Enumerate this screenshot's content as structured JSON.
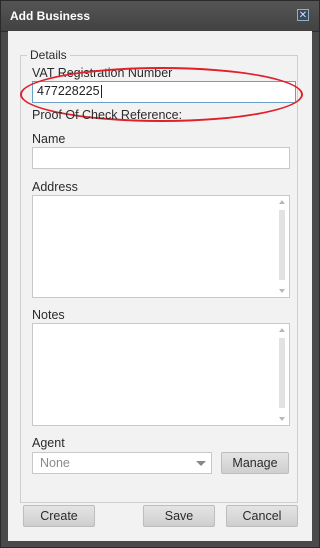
{
  "window": {
    "title": "Add Business",
    "close_icon": "close-icon"
  },
  "details": {
    "legend": "Details",
    "vat_label": "VAT Registration Number",
    "vat_value": "477228225",
    "proof_label": "Proof Of Check Reference:",
    "name_label": "Name",
    "name_value": "",
    "address_label": "Address",
    "notes_label": "Notes",
    "agent_label": "Agent",
    "agent_selected": "None",
    "manage_label": "Manage"
  },
  "footer": {
    "create_label": "Create",
    "save_label": "Save",
    "cancel_label": "Cancel"
  },
  "colors": {
    "highlight": "#e0202a",
    "titlebar": "#4a4a4a",
    "panel": "#f2f2f2"
  }
}
